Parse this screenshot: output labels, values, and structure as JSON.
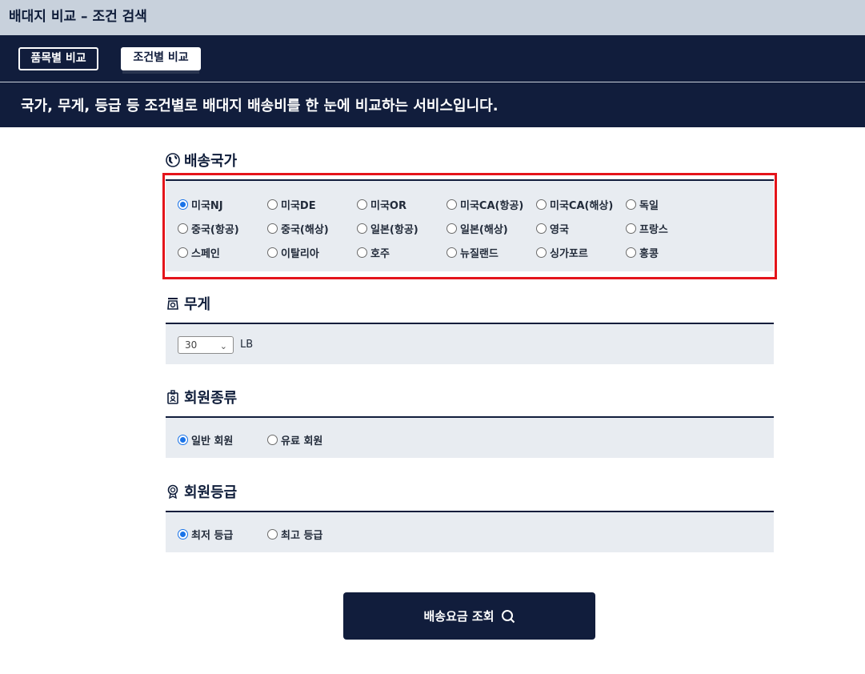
{
  "header": {
    "title": "배대지 비교 – 조건 검색"
  },
  "tabs": [
    {
      "label": "품목별 비교"
    },
    {
      "label": "조건별 비교"
    }
  ],
  "banner": {
    "text": "국가, 무게, 등급 등 조건별로 배대지 배송비를 한 눈에 비교하는 서비스입니다."
  },
  "country": {
    "title": "배송국가",
    "icon": "globe-icon",
    "selected": "미국NJ",
    "rows": [
      [
        "미국NJ",
        "미국DE",
        "미국OR",
        "미국CA(항공)",
        "미국CA(해상)",
        "독일"
      ],
      [
        "중국(항공)",
        "중국(해상)",
        "일본(항공)",
        "일본(해상)",
        "영국",
        "프랑스"
      ],
      [
        "스페인",
        "이탈리아",
        "호주",
        "뉴질랜드",
        "싱가포르",
        "홍콩"
      ]
    ]
  },
  "weight": {
    "title": "무게",
    "icon": "weight-icon",
    "value": "30",
    "unit": "LB"
  },
  "membership": {
    "title": "회원종류",
    "icon": "badge-icon",
    "options": [
      "일반 회원",
      "유료 회원"
    ],
    "selected": "일반 회원"
  },
  "grade": {
    "title": "회원등급",
    "icon": "medal-icon",
    "options": [
      "최저 등급",
      "최고 등급"
    ],
    "selected": "최저 등급"
  },
  "search_button": {
    "label": "배송요금 조회",
    "icon": "search-icon"
  },
  "colors": {
    "navy": "#111d3c",
    "panel": "#e8ecf1",
    "highlight": "#e4141b",
    "radio": "#1a73e8"
  }
}
